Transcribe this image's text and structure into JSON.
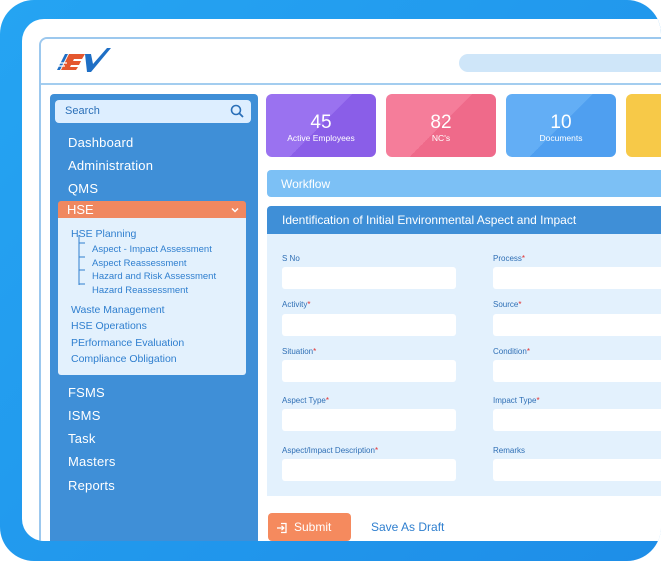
{
  "colors": {
    "brand_blue": "#3f8fd7",
    "accent_orange": "#f08860",
    "light_panel": "#e3f1fd",
    "frame_blue": "#1e8ee8"
  },
  "header": {
    "logo_text": "EV"
  },
  "sidebar": {
    "search": {
      "label": "Search",
      "icon": "search-icon"
    },
    "items_top": [
      "Dashboard",
      "Administration",
      "QMS"
    ],
    "active": {
      "label": "HSE",
      "icon": "chevron-down-icon"
    },
    "hse_planning": "HSE Planning",
    "planning_children": [
      "Aspect - Impact Assessment",
      "Aspect Reassessment",
      "Hazard and Risk Assessment",
      "Hazard Reassessment"
    ],
    "hse_items": [
      "Waste Management",
      "HSE Operations",
      "PErformance Evaluation",
      "Compliance Obligation"
    ],
    "items_bottom": [
      "FSMS",
      "ISMS",
      "Task",
      "Masters",
      "Reports"
    ]
  },
  "cards": [
    {
      "value": "45",
      "label": "Active Employees"
    },
    {
      "value": "82",
      "label": "NC's"
    },
    {
      "value": "10",
      "label": "Documents"
    }
  ],
  "workflow": {
    "label": "Workflow"
  },
  "form": {
    "title": "Identification of Initial Environmental Aspect and Impact",
    "fields_left": [
      {
        "label": "S No",
        "required": false
      },
      {
        "label": "Activity",
        "required": true
      },
      {
        "label": "Situation",
        "required": true
      },
      {
        "label": "Aspect Type",
        "required": true
      },
      {
        "label": "Aspect/Impact Description",
        "required": true
      }
    ],
    "fields_right": [
      {
        "label": "Process",
        "required": true
      },
      {
        "label": "Source",
        "required": true
      },
      {
        "label": "Condition",
        "required": true
      },
      {
        "label": "Impact Type",
        "required": true
      },
      {
        "label": "Remarks",
        "required": false
      }
    ],
    "required_mark": "*"
  },
  "actions": {
    "submit": "Submit",
    "submit_icon": "login-arrow-icon",
    "draft": "Save As Draft"
  }
}
